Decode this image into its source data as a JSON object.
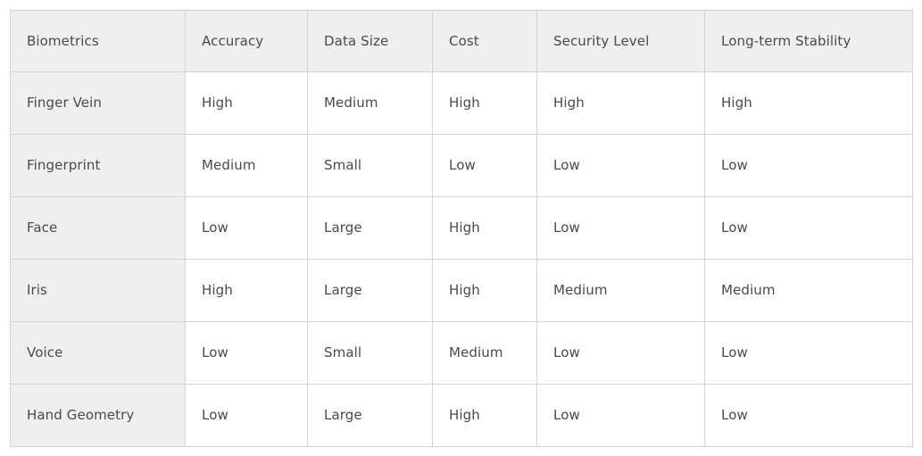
{
  "table": {
    "columns": [
      "Biometrics",
      "Accuracy",
      "Data Size",
      "Cost",
      "Security Level",
      "Long-term Stability"
    ],
    "rows": [
      {
        "label": "Finger Vein",
        "accuracy": "High",
        "data_size": "Medium",
        "cost": "High",
        "security_level": "High",
        "long_term_stability": "High"
      },
      {
        "label": "Fingerprint",
        "accuracy": "Medium",
        "data_size": "Small",
        "cost": "Low",
        "security_level": "Low",
        "long_term_stability": "Low"
      },
      {
        "label": "Face",
        "accuracy": "Low",
        "data_size": "Large",
        "cost": "High",
        "security_level": "Low",
        "long_term_stability": "Low"
      },
      {
        "label": "Iris",
        "accuracy": "High",
        "data_size": "Large",
        "cost": "High",
        "security_level": "Medium",
        "long_term_stability": "Medium"
      },
      {
        "label": "Voice",
        "accuracy": "Low",
        "data_size": "Small",
        "cost": "Medium",
        "security_level": "Low",
        "long_term_stability": "Low"
      },
      {
        "label": "Hand Geometry",
        "accuracy": "Low",
        "data_size": "Large",
        "cost": "High",
        "security_level": "Low",
        "long_term_stability": "Low"
      }
    ]
  },
  "colors": {
    "header_background": "#efefef",
    "row_header_background": "#efefef",
    "cell_background": "#ffffff",
    "border": "#d5d5d5",
    "text": "#4a4a4a",
    "page_background": "#ffffff"
  }
}
